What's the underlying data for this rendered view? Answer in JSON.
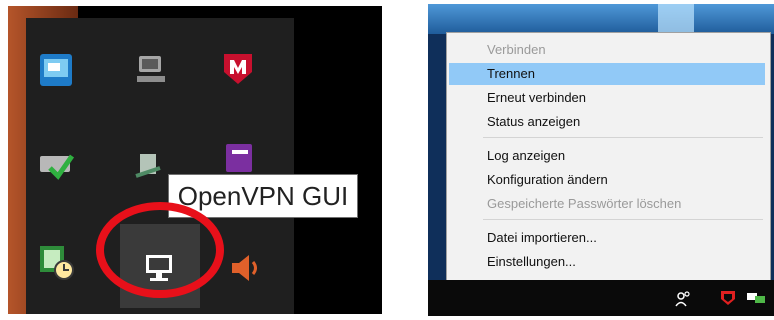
{
  "tooltip": {
    "text": "OpenVPN GUI"
  },
  "tray_icons": [
    "intel-graphics-icon",
    "network-computer-icon",
    "mcafee-icon",
    "checkmark-drive-icon",
    "usb-eject-icon",
    "onenote-icon",
    "task-scheduler-icon",
    "openvpn-icon",
    "speaker-icon"
  ],
  "menu": {
    "items": [
      {
        "label": "Verbinden",
        "state": "disabled"
      },
      {
        "label": "Trennen",
        "state": "selected"
      },
      {
        "label": "Erneut verbinden",
        "state": "normal"
      },
      {
        "label": "Status anzeigen",
        "state": "normal"
      },
      {
        "label": "Log anzeigen",
        "state": "normal"
      },
      {
        "label": "Konfiguration ändern",
        "state": "normal"
      },
      {
        "label": "Gespeicherte Passwörter löschen",
        "state": "disabled"
      },
      {
        "label": "Datei importieren...",
        "state": "normal"
      },
      {
        "label": "Einstellungen...",
        "state": "normal"
      }
    ]
  },
  "taskbar_icons": [
    "people-icon",
    "mcafee-icon",
    "network-icon"
  ],
  "colors": {
    "highlight": "#91c9f7",
    "ring": "#e8101a",
    "menu_bg": "#f2f2f2",
    "disabled_text": "#9a9a9a"
  }
}
